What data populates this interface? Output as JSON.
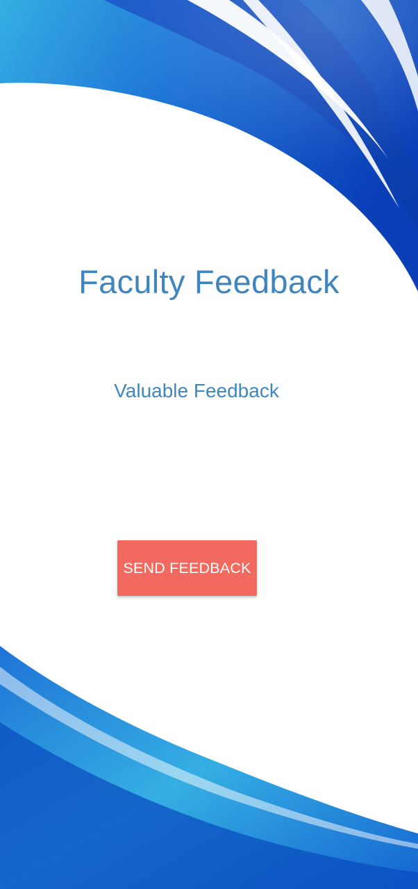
{
  "app": {
    "title": "Faculty Feedback",
    "subtitle": "Valuable Feedback"
  },
  "actions": {
    "send_label": "SEND FEEDBACK"
  },
  "colors": {
    "text_blue": "#3f86c0",
    "button_red": "#f26a5f",
    "wave_dark": "#0a3fb8",
    "wave_mid": "#1e74d6",
    "wave_light": "#35aee3"
  },
  "background": {
    "icon": "blue-wave-background"
  }
}
